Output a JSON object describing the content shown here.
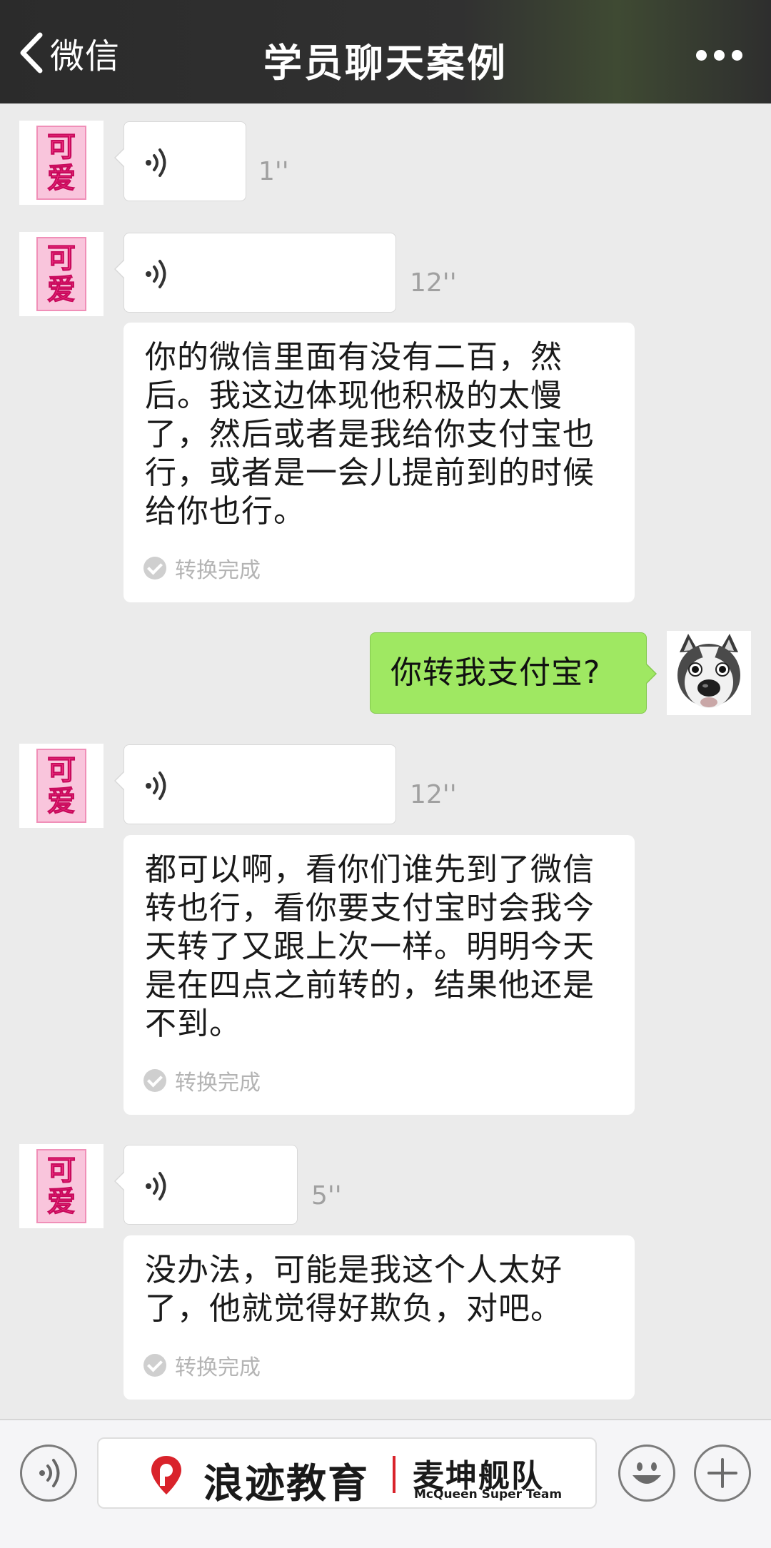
{
  "navbar": {
    "back_label": "微信",
    "title": "学员聊天案例",
    "more_icon": "more-icon"
  },
  "messages": [
    {
      "type": "voice",
      "sender": "contact",
      "duration": "1''"
    },
    {
      "type": "voice",
      "sender": "contact",
      "duration": "12''",
      "transcript": "你的微信里面有没有二百，然后。我这边体现他积极的太慢了，然后或者是我给你支付宝也行，或者是一会儿提前到的时候给你也行。",
      "status": "转换完成"
    },
    {
      "type": "text",
      "sender": "me",
      "text": "你转我支付宝?"
    },
    {
      "type": "voice",
      "sender": "contact",
      "duration": "12''",
      "transcript": "都可以啊，看你们谁先到了微信转也行，看你要支付宝时会我今天转了又跟上次一样。明明今天是在四点之前转的，结果他还是不到。",
      "status": "转换完成"
    },
    {
      "type": "voice",
      "sender": "contact",
      "duration": "5''",
      "transcript": "没办法，可能是我这个人太好了，他就觉得好欺负，对吧。",
      "status": "转换完成"
    }
  ],
  "contact_avatar": {
    "char1": "可",
    "char2": "爱"
  },
  "my_avatar": {
    "icon": "husky-avatar"
  },
  "inputbar": {
    "voice_icon": "voice-input-icon",
    "brand_name": "浪迹教育",
    "brand_team": "麦坤舰队",
    "brand_en": "McQueen Super Team",
    "emoji_icon": "emoji-icon",
    "plus_icon": "plus-icon"
  },
  "colors": {
    "navbar": "#2b2b2b",
    "background": "#ebebeb",
    "out_bubble": "#9fe862",
    "brand_red": "#d9232b"
  }
}
